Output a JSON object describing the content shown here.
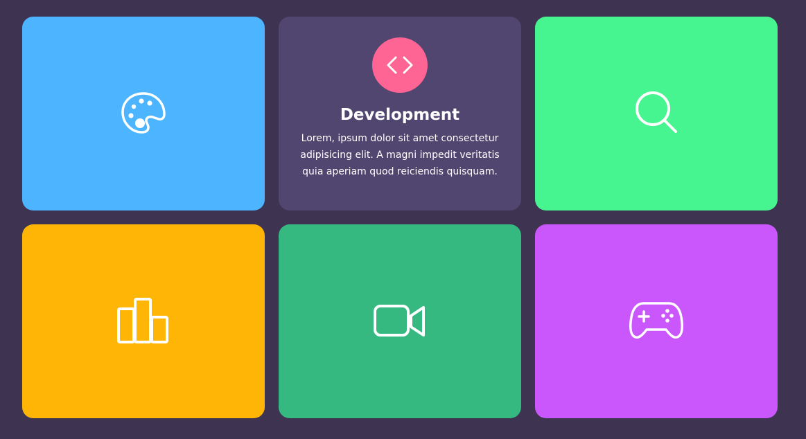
{
  "page": {
    "background": "#3e3451"
  },
  "cards": [
    {
      "icon": "palette-icon",
      "color": "#4db5ff"
    },
    {
      "icon": "code-icon",
      "color": "#514670",
      "badge_color": "#ff6594",
      "title": "Development",
      "description": "Lorem, ipsum dolor sit amet consectetur adipisicing elit. A magni impedit veritatis quia aperiam quod reiciendis quisquam."
    },
    {
      "icon": "search-icon",
      "color": "#47f590"
    },
    {
      "icon": "bar-chart-icon",
      "color": "#ffb505"
    },
    {
      "icon": "video-camera-icon",
      "color": "#36b981"
    },
    {
      "icon": "gamepad-icon",
      "color": "#c957fb"
    }
  ]
}
